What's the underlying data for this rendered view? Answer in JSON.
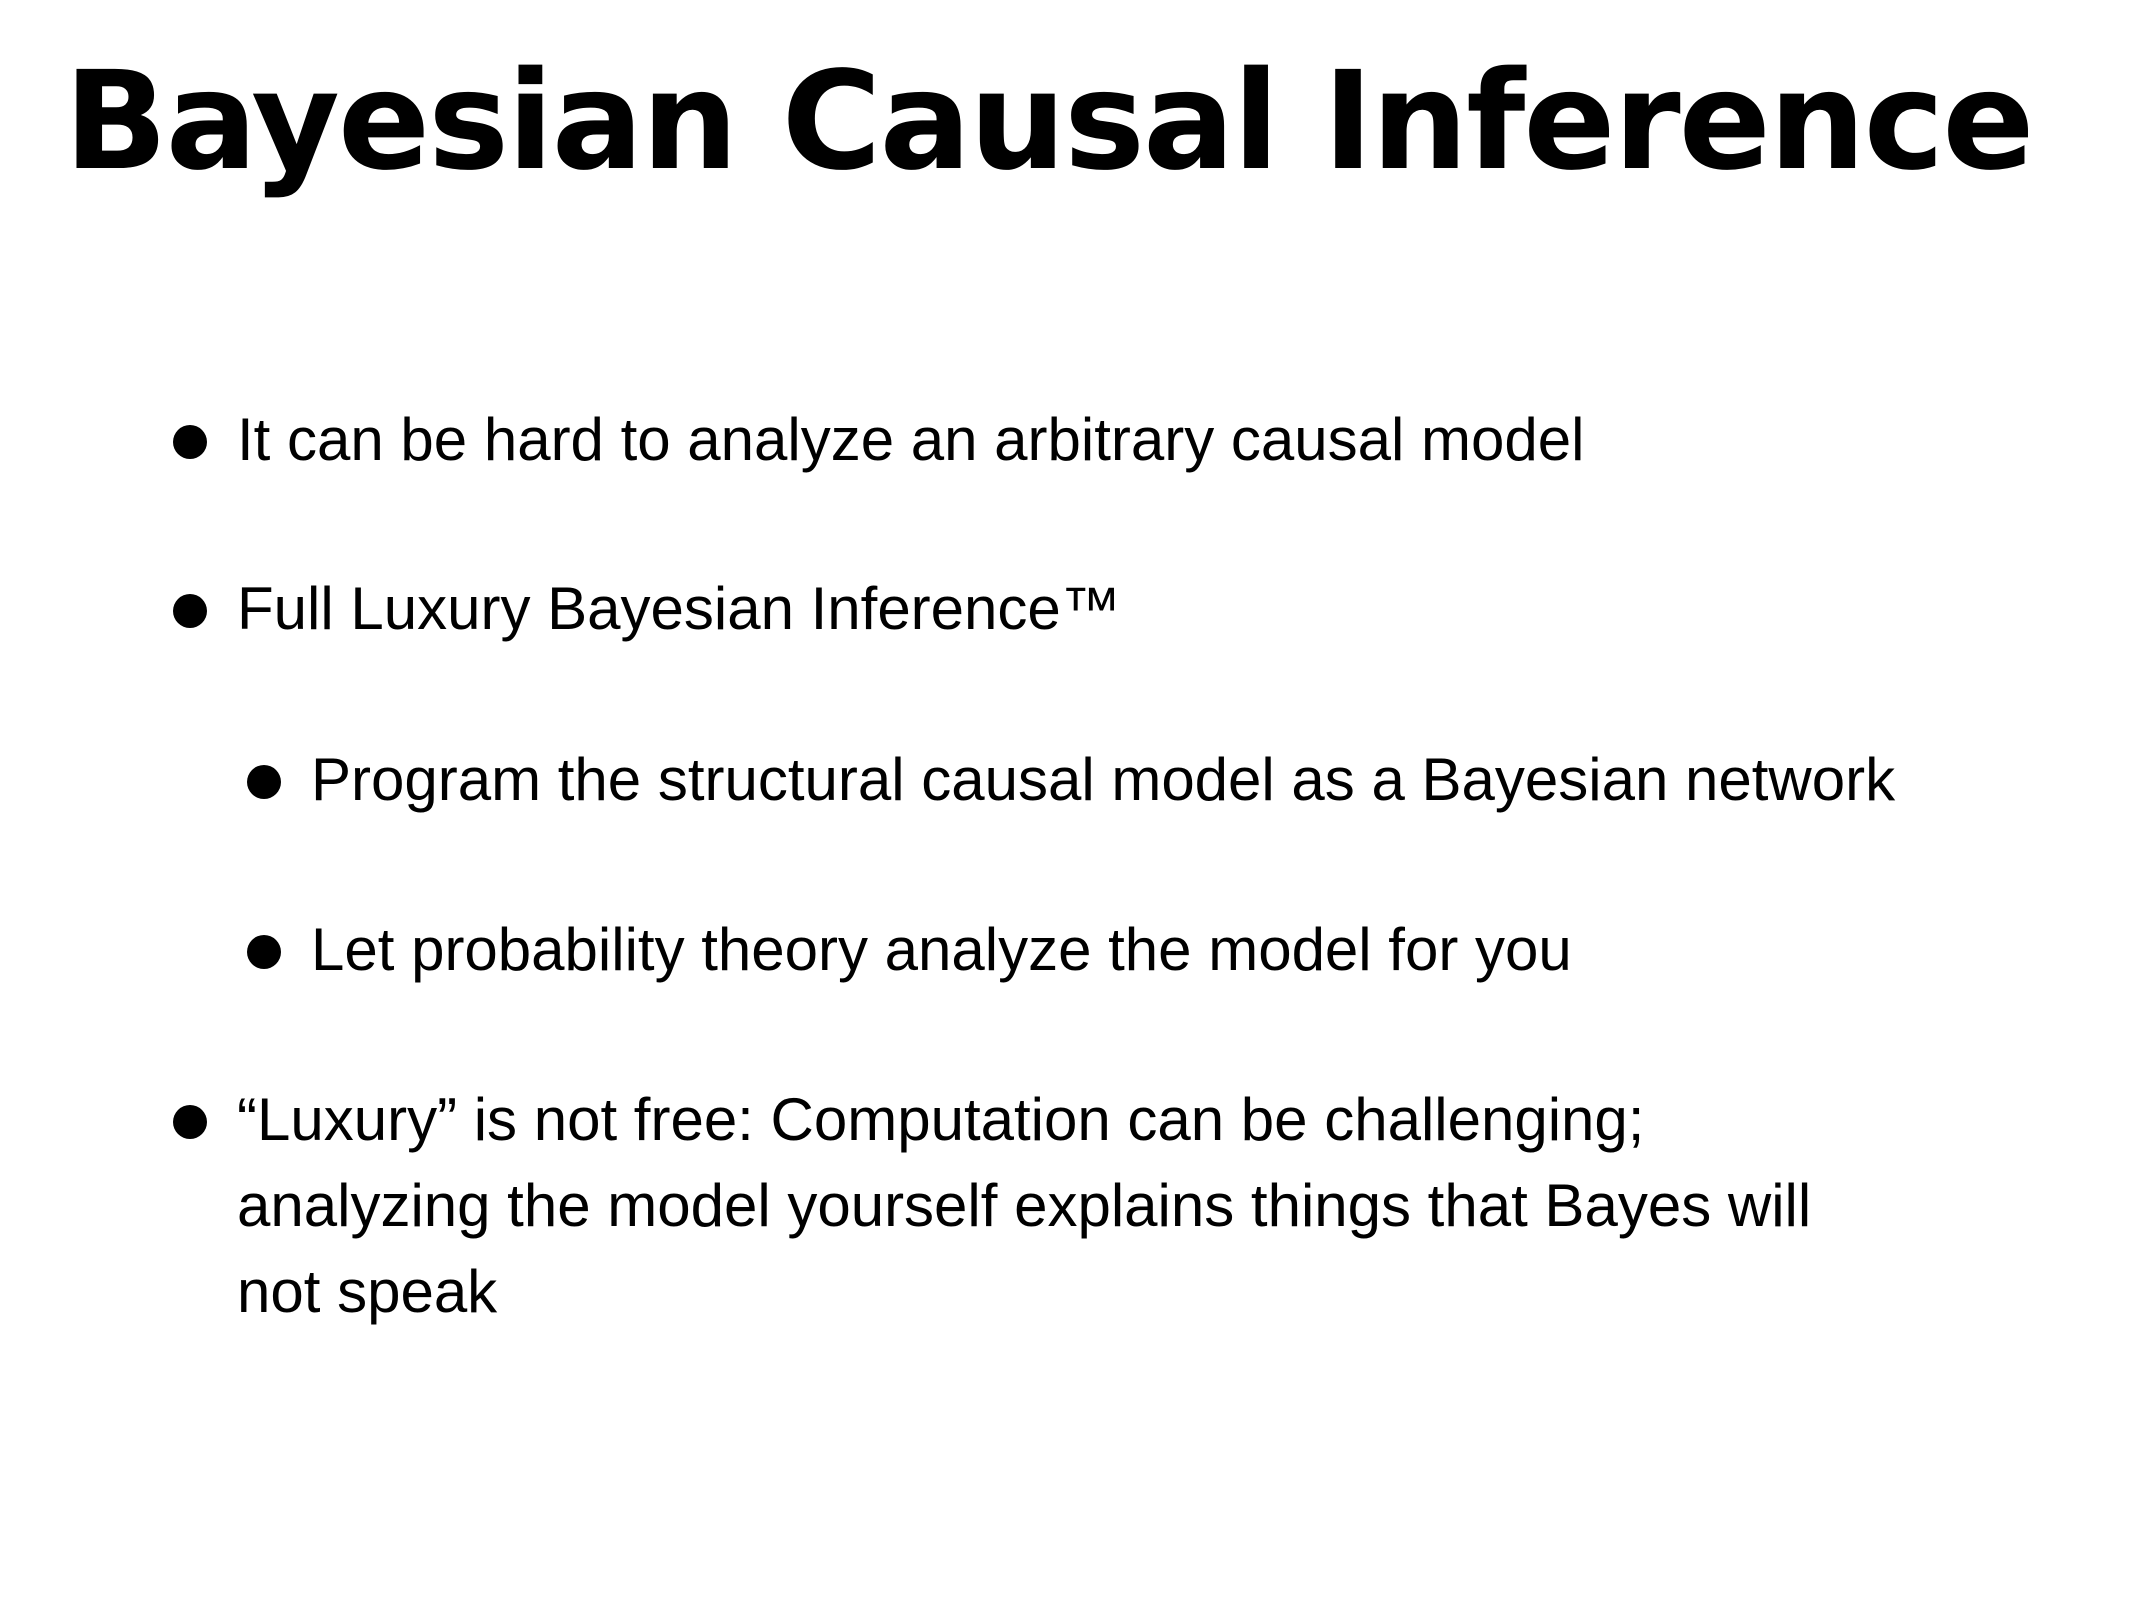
{
  "slide": {
    "title": "Bayesian Causal Inference",
    "bullets": [
      {
        "text": "It can be hard to analyze an arbitrary causal model",
        "level": 1
      },
      {
        "text": "Full Luxury Bayesian Inference™",
        "level": 1
      },
      {
        "text": "Program the structural causal model as a Bayesian network",
        "level": 2
      },
      {
        "text": "Let probability theory analyze the model for you",
        "level": 2
      },
      {
        "level": 1,
        "lines": [
          "“Luxury” is not free: Computation can be challenging;",
          "analyzing the model yourself explains things that Bayes will",
          "not speak"
        ]
      }
    ]
  }
}
